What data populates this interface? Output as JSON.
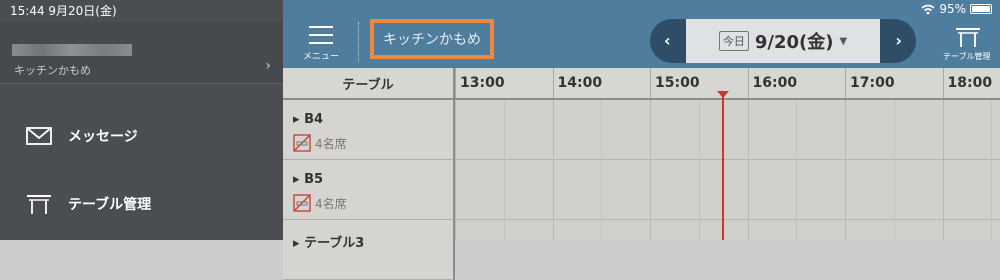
{
  "status": {
    "time_date": "15:44  9月20日(金)",
    "battery": "95%"
  },
  "sidebar": {
    "account_shop": "キッチンかもめ",
    "items": [
      {
        "label": "メッセージ",
        "icon": "envelope-icon"
      },
      {
        "label": "テーブル管理",
        "icon": "table-icon"
      }
    ]
  },
  "header": {
    "menu_label": "メニュー",
    "shop_name": "キッチンかもめ",
    "today_badge": "今日",
    "date": "9/20(金)",
    "table_mgmt_label": "テーブル管理",
    "accent": "#f0873a",
    "bar_color": "#4e7d9e"
  },
  "timeline": {
    "table_header": "テーブル",
    "hours": [
      "13:00",
      "14:00",
      "15:00",
      "16:00",
      "17:00",
      "18:00"
    ],
    "rows": [
      {
        "name": "B4",
        "seats": "4名席"
      },
      {
        "name": "B5",
        "seats": "4名席"
      },
      {
        "name": "テーブル3",
        "seats": ""
      }
    ],
    "now_line_color": "#d9322a"
  }
}
